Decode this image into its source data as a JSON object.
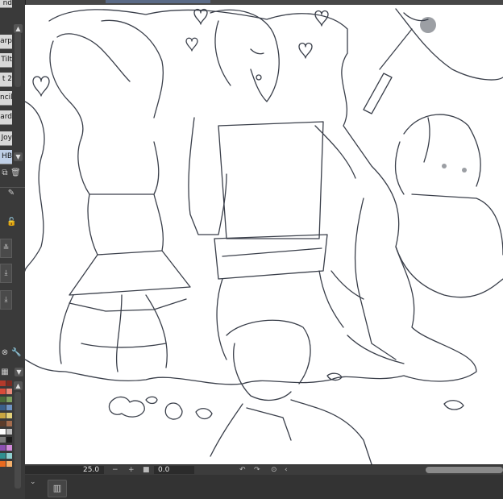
{
  "brush_panel": {
    "items": [
      {
        "label": "nd"
      },
      {
        "label": "arp"
      },
      {
        "label": "Tilt"
      },
      {
        "label": "t 2"
      },
      {
        "label": "ncil"
      },
      {
        "label": "ard"
      },
      {
        "label": "Joy"
      },
      {
        "label": "HB"
      }
    ],
    "selected_index": 7
  },
  "status_bar": {
    "zoom": "25.0",
    "rotation": "0.0",
    "zoom_out_icon": "minus-icon",
    "zoom_in_icon": "plus-icon",
    "reset_icon": "square-icon",
    "rotate_left_icon": "rotate-left-icon",
    "rotate_right_icon": "rotate-right-icon",
    "rotate_reset_icon": "rotate-reset-icon",
    "flip_icon": "chevron-left-icon"
  },
  "palette": {
    "colors": [
      "#b33a2b",
      "#7a2b22",
      "#d94b3a",
      "#e98a7a",
      "#4b6b3a",
      "#7fa060",
      "#3a5f8a",
      "#6f93c2",
      "#c9a640",
      "#e2d07a",
      "#5c3c2a",
      "#a56d4e",
      "#ffffff",
      "#bdbdbd",
      "#7d7d7d",
      "#1c1c1c",
      "#8a4fb0",
      "#d08ad9",
      "#2f8f8f",
      "#8fd0d0",
      "#e86a1f",
      "#f5b06b"
    ]
  },
  "colors": {
    "panel_bg": "#3a3a3a",
    "canvas_bg": "#ffffff",
    "selected_brush": "#bfcfe6",
    "sketch_line": "#3a3f4a"
  }
}
